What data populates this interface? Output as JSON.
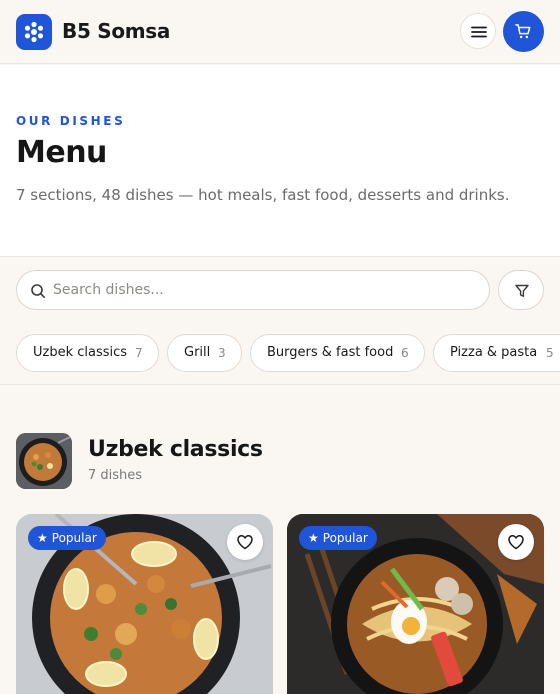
{
  "header": {
    "brand": "B5 Somsa",
    "logo_icon": "flower-logo-icon",
    "menu_icon": "hamburger-icon",
    "cart_icon": "cart-icon"
  },
  "hero": {
    "eyebrow": "OUR DISHES",
    "title": "Menu",
    "subtitle": "7 sections, 48 dishes — hot meals, fast food, desserts and drinks."
  },
  "search": {
    "placeholder": "Search dishes...",
    "value": "",
    "icon": "search-icon",
    "filter_icon": "filter-icon"
  },
  "categories": [
    {
      "label": "Uzbek classics",
      "count": "7"
    },
    {
      "label": "Grill",
      "count": "3"
    },
    {
      "label": "Burgers & fast food",
      "count": "6"
    },
    {
      "label": "Pizza & pasta",
      "count": "5"
    }
  ],
  "section": {
    "title": "Uzbek classics",
    "count_text": "7 dishes"
  },
  "cards": [
    {
      "badge": "Popular",
      "badge_icon": "star-icon",
      "fav_icon": "heart-icon"
    },
    {
      "badge": "Popular",
      "badge_icon": "star-icon",
      "fav_icon": "heart-icon"
    }
  ],
  "colors": {
    "accent": "#1f55d6",
    "background": "#faf7f3",
    "surface": "#ffffff"
  }
}
